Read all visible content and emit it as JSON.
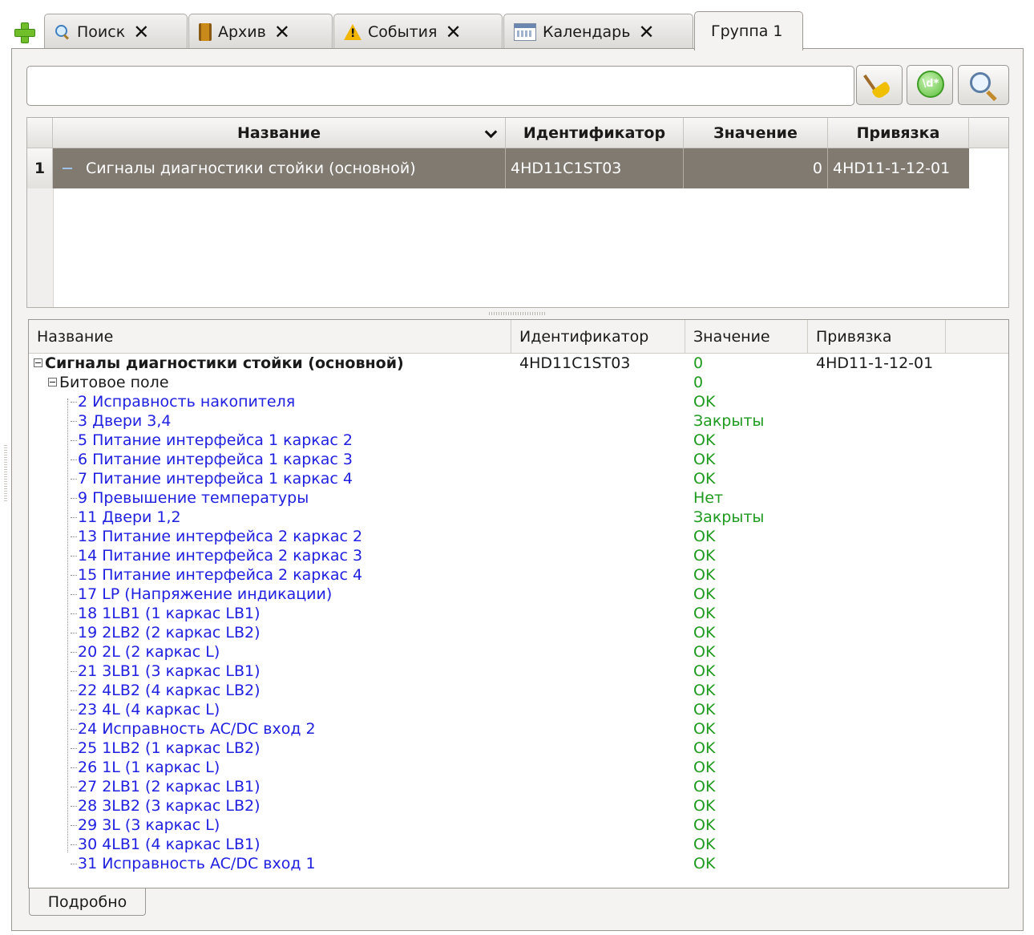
{
  "tabs": [
    {
      "label": "Поиск",
      "icon": "search-icon",
      "closable": true
    },
    {
      "label": "Архив",
      "icon": "archive-icon",
      "closable": true
    },
    {
      "label": "События",
      "icon": "warning-icon",
      "closable": true
    },
    {
      "label": "Календарь",
      "icon": "calendar-icon",
      "closable": true
    },
    {
      "label": "Группа 1",
      "active": true,
      "closable": false
    }
  ],
  "filter": {
    "value": "",
    "placeholder": ""
  },
  "toolbar": {
    "clear_icon": "broom-icon",
    "regex_icon": "regex-icon",
    "regex_text": "\\d*",
    "find_icon": "magnifier-icon"
  },
  "top_table": {
    "headers": {
      "name": "Название",
      "id": "Идентификатор",
      "value": "Значение",
      "binding": "Привязка"
    },
    "rows": [
      {
        "num": "1",
        "name": "Сигналы диагностики стойки (основной)",
        "id": "4HD11C1ST03",
        "value": "0",
        "binding": "4HD11-1-12-01"
      }
    ]
  },
  "tree": {
    "headers": {
      "name": "Название",
      "id": "Идентификатор",
      "value": "Значение",
      "binding": "Привязка"
    },
    "root": {
      "name": "Сигналы диагностики стойки (основной)",
      "id": "4HD11C1ST03",
      "value": "0",
      "binding": "4HD11-1-12-01"
    },
    "group": {
      "name": "Битовое поле",
      "value": "0"
    },
    "items": [
      {
        "name": "2 Исправность накопителя",
        "value": "OK"
      },
      {
        "name": "3 Двери 3,4",
        "value": "Закрыты"
      },
      {
        "name": "5 Питание интерфейса 1 каркас 2",
        "value": "OK"
      },
      {
        "name": "6 Питание интерфейса 1 каркас 3",
        "value": "OK"
      },
      {
        "name": "7 Питание интерфейса 1 каркас 4",
        "value": "OK"
      },
      {
        "name": "9 Превышение температуры",
        "value": "Нет"
      },
      {
        "name": "11 Двери 1,2",
        "value": "Закрыты"
      },
      {
        "name": "13 Питание интерфейса 2 каркас 2",
        "value": "OK"
      },
      {
        "name": "14 Питание интерфейса 2 каркас 3",
        "value": "OK"
      },
      {
        "name": "15 Питание интерфейса 2 каркас 4",
        "value": "OK"
      },
      {
        "name": "17 LP (Напряжение индикации)",
        "value": "OK"
      },
      {
        "name": "18 1LB1 (1 каркас LB1)",
        "value": "OK"
      },
      {
        "name": "19 2LB2 (2 каркас LB2)",
        "value": "OK"
      },
      {
        "name": "20 2L (2 каркас L)",
        "value": "OK"
      },
      {
        "name": "21 3LB1 (3 каркас LB1)",
        "value": "OK"
      },
      {
        "name": "22 4LB2 (4 каркас LB2)",
        "value": "OK"
      },
      {
        "name": "23 4L (4 каркас L)",
        "value": "OK"
      },
      {
        "name": "24 Исправность AC/DC вход 2",
        "value": "OK"
      },
      {
        "name": "25 1LB2  (1 каркас LB2)",
        "value": "OK"
      },
      {
        "name": "26 1L (1 каркас L)",
        "value": "OK"
      },
      {
        "name": "27 2LB1 (2 каркас LB1)",
        "value": "OK"
      },
      {
        "name": "28 3LB2 (3 каркас LB2)",
        "value": "OK"
      },
      {
        "name": "29 3L (3 каркас L)",
        "value": "OK"
      },
      {
        "name": "30 4LB1 (4 каркас LB1)",
        "value": "OK"
      },
      {
        "name": "31 Исправность AC/DC вход 1",
        "value": "OK"
      }
    ]
  },
  "bottom_tab": {
    "label": "Подробно"
  },
  "colors": {
    "selection": "#807a71",
    "tree_item": "#2020e0",
    "value_ok": "#1e9a1e"
  }
}
